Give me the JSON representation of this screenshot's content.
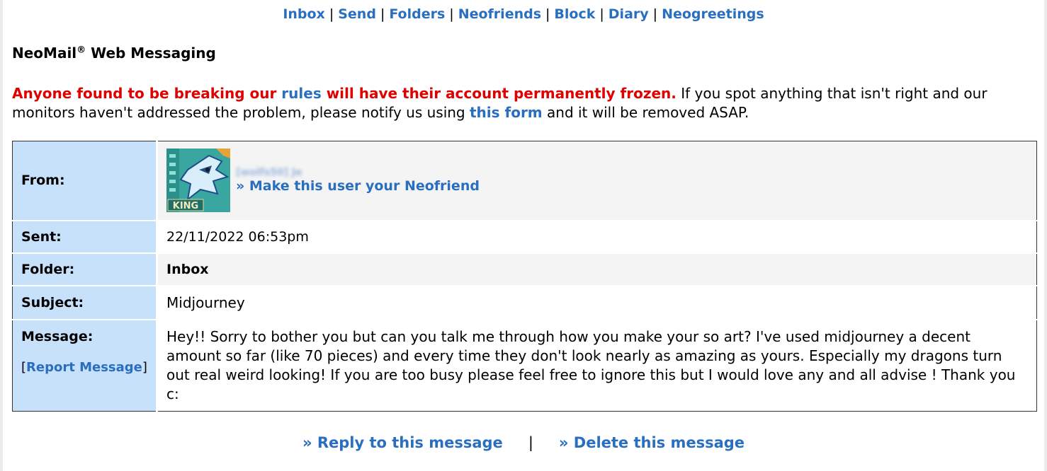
{
  "nav": {
    "items": [
      "Inbox",
      "Send",
      "Folders",
      "Neofriends",
      "Block",
      "Diary",
      "Neogreetings"
    ],
    "separator": "|"
  },
  "title": {
    "main": "NeoMail",
    "registered": "®",
    "rest": " Web Messaging"
  },
  "warning": {
    "red_1": "Anyone found to be breaking our ",
    "rules_link": "rules",
    "red_2": " will have their account permanently frozen.",
    "text_1": " If you spot anything that isn't right and our monitors haven't addressed the problem, please notify us using ",
    "form_link": "this form",
    "text_2": " and it will be removed ASAP."
  },
  "mail": {
    "from_label": "From:",
    "from_username": "[wolfs50] Je",
    "avatar_badge": "KING",
    "neofriend_link": "» Make this user your Neofriend",
    "sent_label": "Sent:",
    "sent_value": "22/11/2022 06:53pm",
    "folder_label": "Folder:",
    "folder_value": "Inbox",
    "subject_label": "Subject:",
    "subject_value": "Midjourney",
    "message_label": "Message:",
    "report_open": "[",
    "report_link": "Report Message",
    "report_close": "]",
    "message_value": "Hey!! Sorry to bother you but can you talk me through how you make your so art? I've used midjourney a decent amount so far (like 70 pieces) and every time they don't look nearly as amazing as yours. Especially my dragons turn out real weird looking! If you are too busy please feel free to ignore this but I would love any and all advise ! Thank you c:"
  },
  "actions": {
    "reply": "» Reply to this message",
    "separator": "|",
    "delete": "» Delete this message"
  },
  "colors": {
    "link": "#2a6fbf",
    "warning_red": "#e00000",
    "label_bg": "#c8e1fb"
  }
}
